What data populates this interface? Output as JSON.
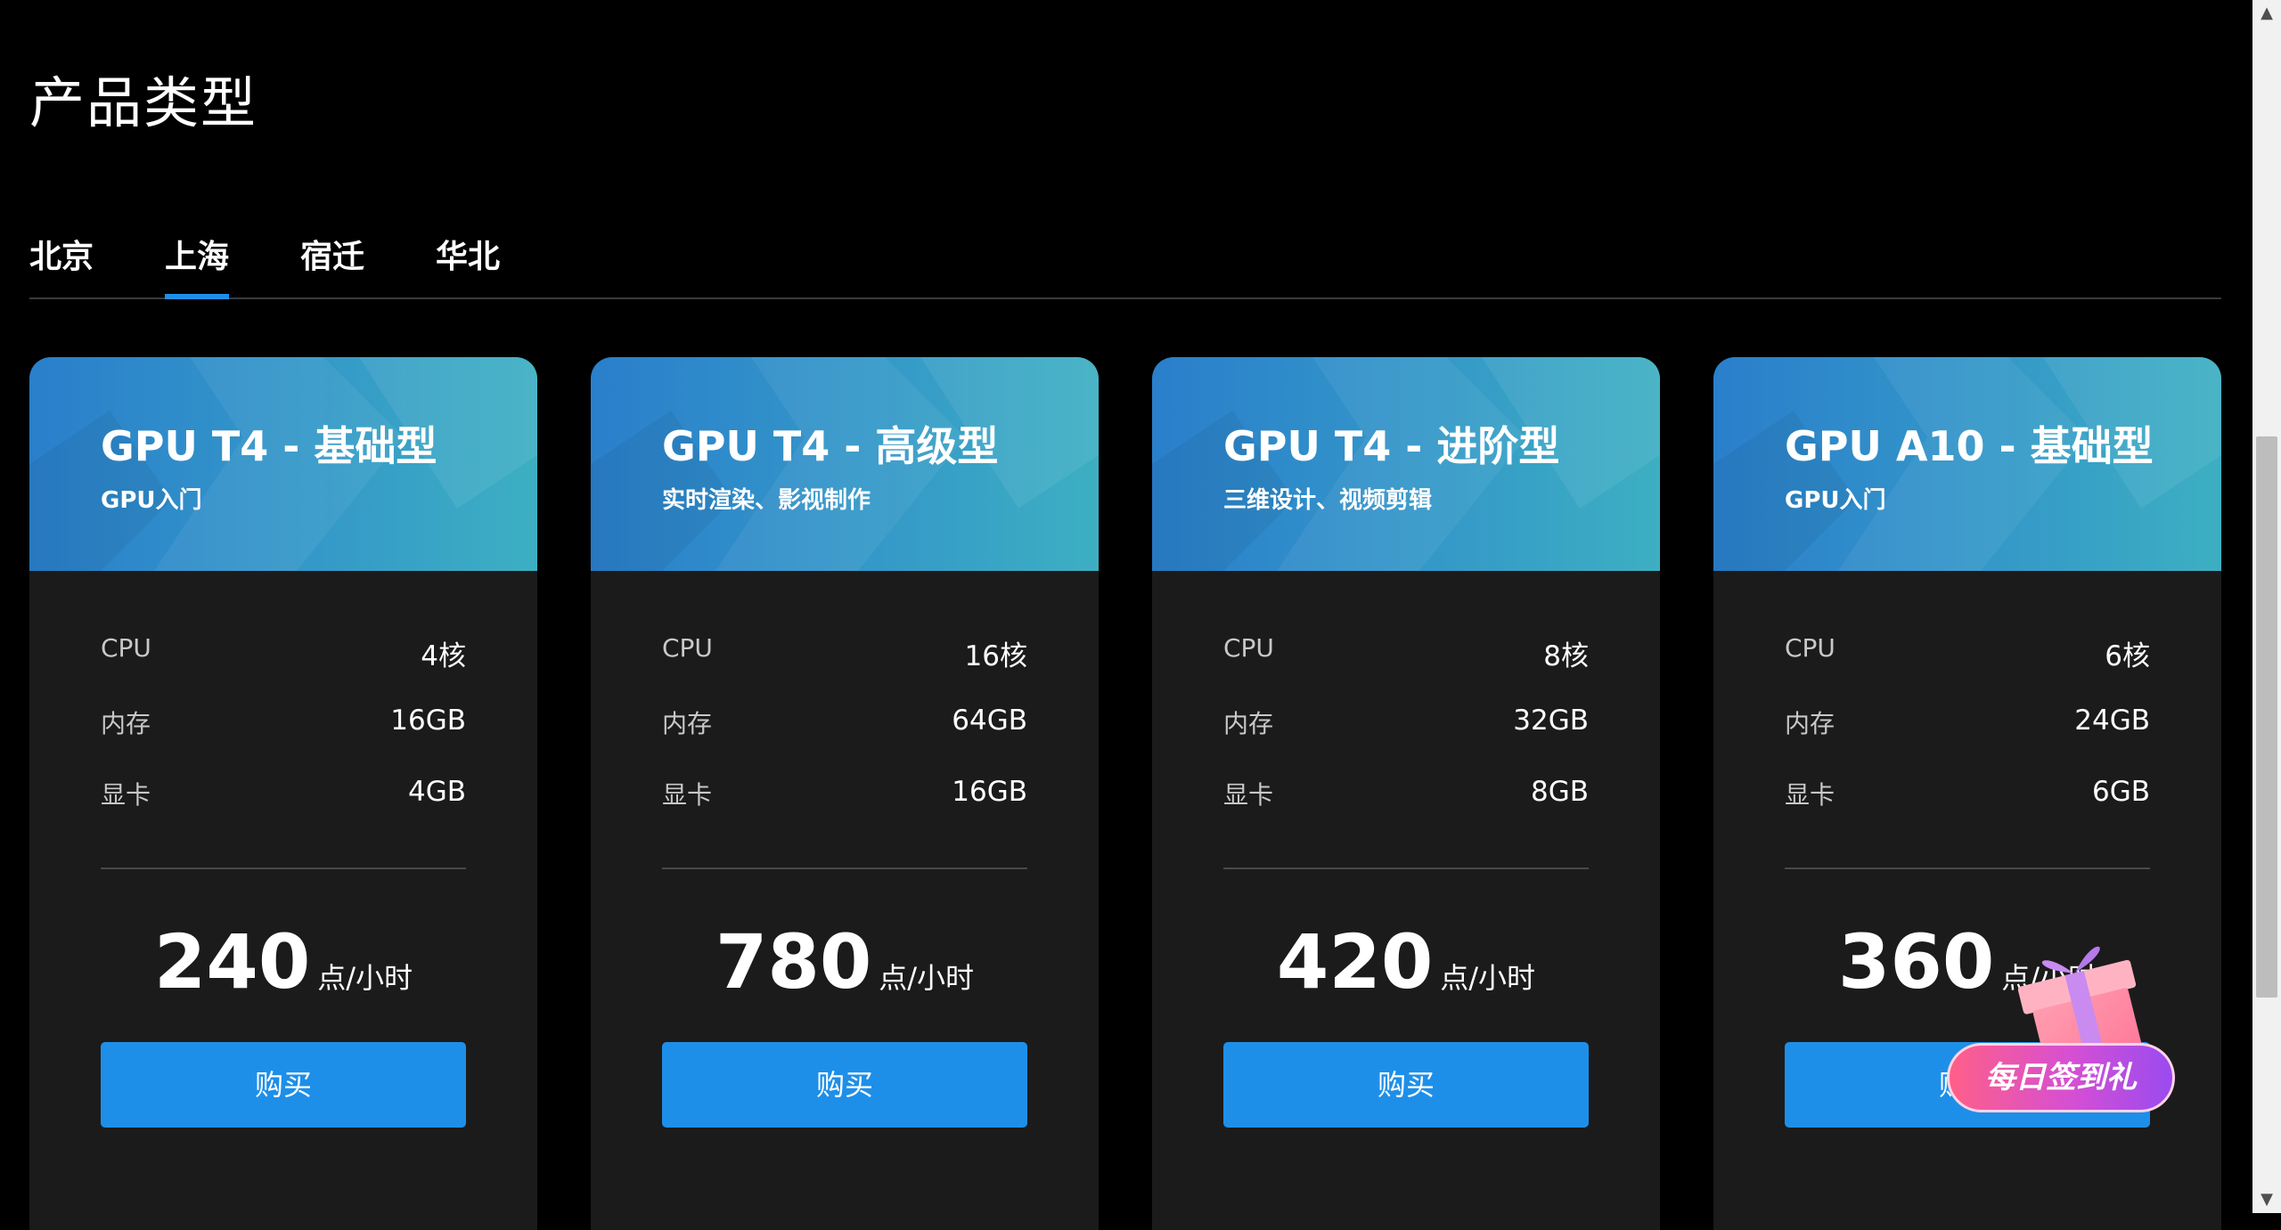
{
  "page": {
    "title": "产品类型"
  },
  "tabs": [
    {
      "label": "北京",
      "active": false
    },
    {
      "label": "上海",
      "active": true
    },
    {
      "label": "宿迁",
      "active": false
    },
    {
      "label": "华北",
      "active": false
    }
  ],
  "cards": [
    {
      "title": "GPU T4 - 基础型",
      "subtitle": "GPU入门",
      "specs": [
        {
          "label": "CPU",
          "value": "4核"
        },
        {
          "label": "内存",
          "value": "16GB"
        },
        {
          "label": "显卡",
          "value": "4GB"
        }
      ],
      "price": "240",
      "unit": "点/小时",
      "button": "购买"
    },
    {
      "title": "GPU T4 - 高级型",
      "subtitle": "实时渲染、影视制作",
      "specs": [
        {
          "label": "CPU",
          "value": "16核"
        },
        {
          "label": "内存",
          "value": "64GB"
        },
        {
          "label": "显卡",
          "value": "16GB"
        }
      ],
      "price": "780",
      "unit": "点/小时",
      "button": "购买"
    },
    {
      "title": "GPU T4 - 进阶型",
      "subtitle": "三维设计、视频剪辑",
      "specs": [
        {
          "label": "CPU",
          "value": "8核"
        },
        {
          "label": "内存",
          "value": "32GB"
        },
        {
          "label": "显卡",
          "value": "8GB"
        }
      ],
      "price": "420",
      "unit": "点/小时",
      "button": "购买"
    },
    {
      "title": "GPU A10 - 基础型",
      "subtitle": "GPU入门",
      "specs": [
        {
          "label": "CPU",
          "value": "6核"
        },
        {
          "label": "内存",
          "value": "24GB"
        },
        {
          "label": "显卡",
          "value": "6GB"
        }
      ],
      "price": "360",
      "unit": "点/小时",
      "button": "购买"
    }
  ],
  "floating_widget": {
    "label": "每日签到礼",
    "icon": "gift-icon"
  },
  "colors": {
    "background": "#000000",
    "card_body": "#1b1b1b",
    "accent_blue": "#1e8fe8",
    "header_gradient_start": "#2a7fcb",
    "header_gradient_end": "#3dafc2"
  }
}
